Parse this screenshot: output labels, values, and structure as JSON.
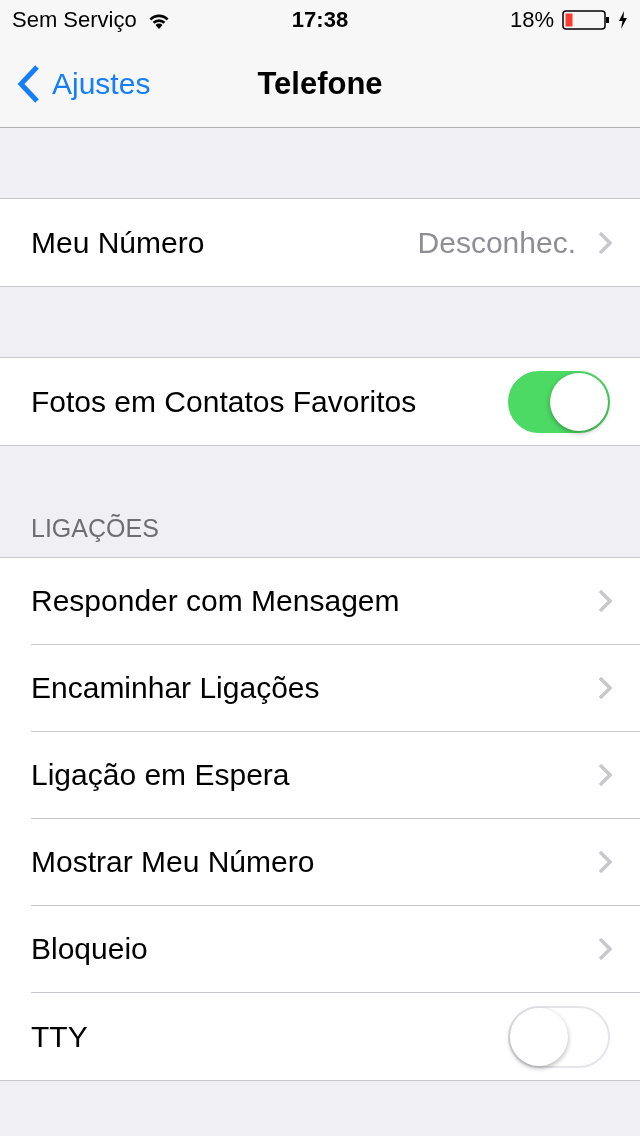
{
  "status_bar": {
    "carrier": "Sem Serviço",
    "time": "17:38",
    "battery": "18%"
  },
  "nav": {
    "back_label": "Ajustes",
    "title": "Telefone"
  },
  "sections": [
    {
      "rows": [
        {
          "kind": "link",
          "label": "Meu Número",
          "value": "Desconhec."
        }
      ]
    },
    {
      "rows": [
        {
          "kind": "toggle",
          "label": "Fotos em Contatos Favoritos",
          "on": true
        }
      ]
    },
    {
      "header": "LIGAÇÕES",
      "rows": [
        {
          "kind": "link",
          "label": "Responder com Mensagem"
        },
        {
          "kind": "link",
          "label": "Encaminhar Ligações"
        },
        {
          "kind": "link",
          "label": "Ligação em Espera"
        },
        {
          "kind": "link",
          "label": "Mostrar Meu Número"
        },
        {
          "kind": "link",
          "label": "Bloqueio"
        },
        {
          "kind": "toggle",
          "label": "TTY",
          "on": false
        }
      ]
    }
  ]
}
